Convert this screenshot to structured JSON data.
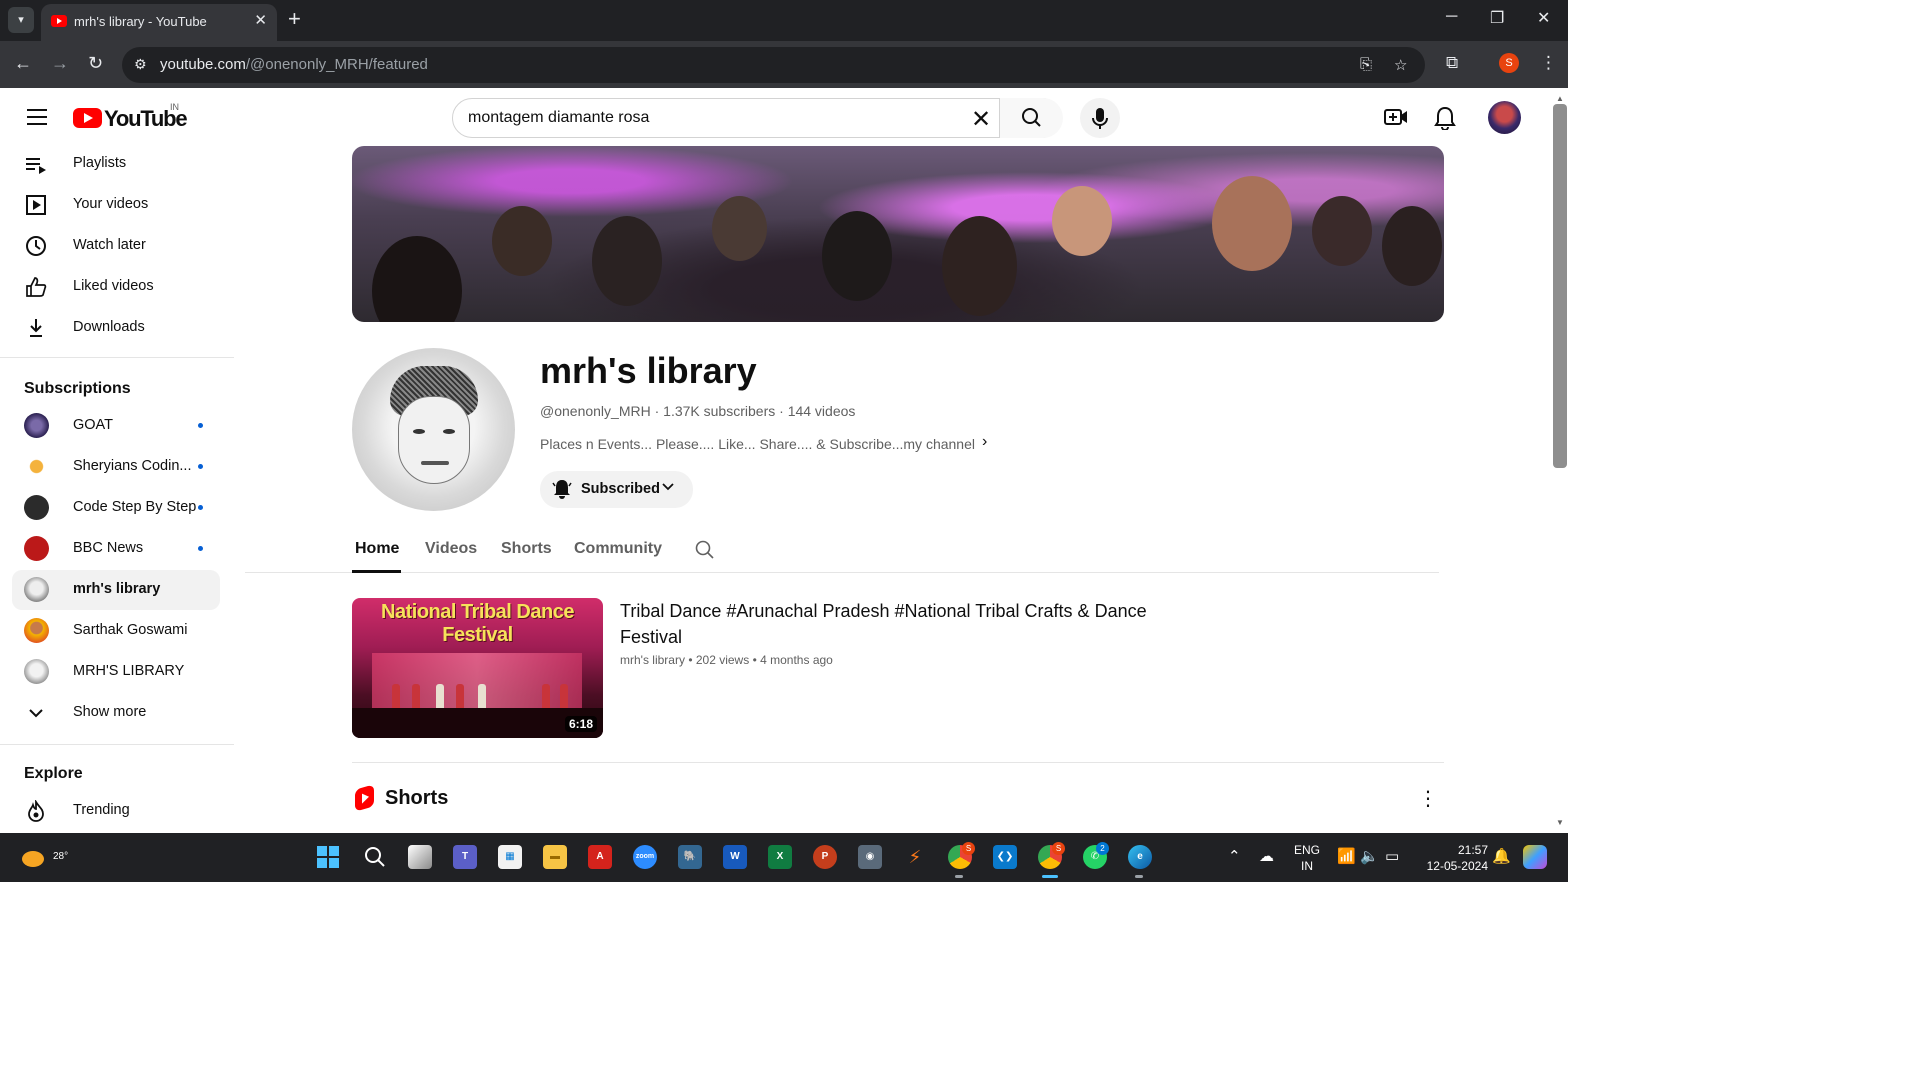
{
  "browser": {
    "tab_title": "mrh's library - YouTube",
    "url_host": "youtube.com",
    "url_path": "/@onenonly_MRH/featured",
    "profile_initial": "S"
  },
  "header": {
    "logo_text": "YouTube",
    "country": "IN",
    "search_value": "montagem diamante rosa"
  },
  "sidebar": {
    "you_items": [
      {
        "label": "Playlists",
        "icon": "playlists-icon"
      },
      {
        "label": "Your videos",
        "icon": "your-videos-icon"
      },
      {
        "label": "Watch later",
        "icon": "clock-icon"
      },
      {
        "label": "Liked videos",
        "icon": "thumbs-up-icon"
      },
      {
        "label": "Downloads",
        "icon": "download-icon"
      }
    ],
    "subscriptions_heading": "Subscriptions",
    "subscriptions": [
      {
        "label": "GOAT",
        "new": true
      },
      {
        "label": "Sheryians Codin...",
        "new": true
      },
      {
        "label": "Code Step By Step",
        "new": true
      },
      {
        "label": "BBC News",
        "new": true
      },
      {
        "label": "mrh's library",
        "new": false,
        "active": true
      },
      {
        "label": "Sarthak Goswami",
        "new": false
      },
      {
        "label": "MRH'S LIBRARY",
        "new": false
      }
    ],
    "show_more": "Show more",
    "explore_heading": "Explore",
    "explore_items": [
      {
        "label": "Trending",
        "icon": "trending-icon"
      }
    ]
  },
  "channel": {
    "name": "mrh's library",
    "handle": "@onenonly_MRH",
    "subscribers": "1.37K subscribers",
    "videos": "144 videos",
    "description": "Places n Events... Please.... Like... Share.... & Subscribe...my channel",
    "subscribed_label": "Subscribed"
  },
  "tabs": [
    "Home",
    "Videos",
    "Shorts",
    "Community"
  ],
  "active_tab": "Home",
  "featured_video": {
    "thumbnail_text": "National Tribal Dance Festival",
    "duration": "6:18",
    "title": "Tribal Dance #Arunachal Pradesh #National Tribal Crafts & Dance Festival",
    "channel": "mrh's library",
    "views": "202 views",
    "age": "4 months ago"
  },
  "shorts_heading": "Shorts",
  "taskbar": {
    "temperature": "28°",
    "lang_line1": "ENG",
    "lang_line2": "IN",
    "time": "21:57",
    "date": "12-05-2024",
    "chrome_badge": "S",
    "whatsapp_badge": "2"
  },
  "colors": {
    "yt_red": "#ff0000",
    "link_blue": "#065fd4",
    "chrome_dark": "#202124"
  }
}
